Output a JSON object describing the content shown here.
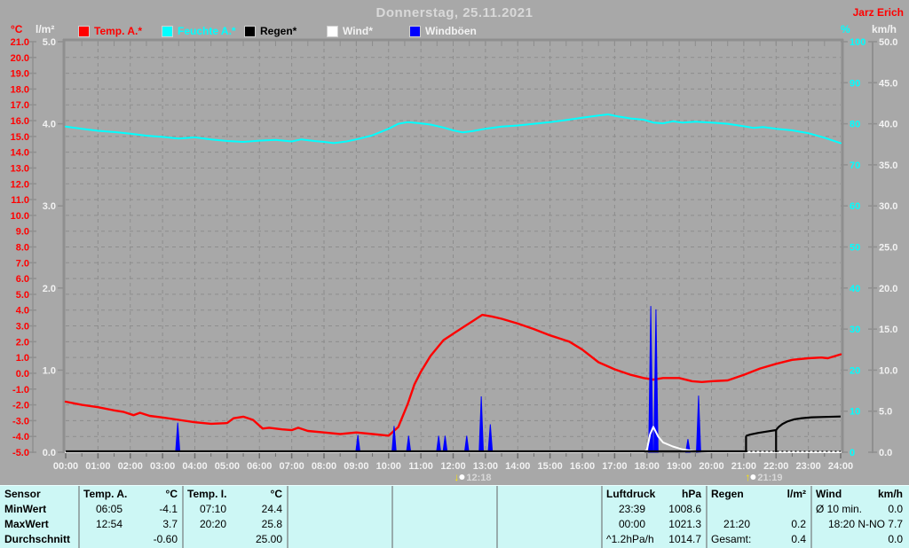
{
  "header": {
    "title": "Donnerstag, 25.11.2021",
    "credit": "Jarz Erich"
  },
  "legend": {
    "items": [
      {
        "label": "Temp. A.*",
        "color": "#ff0000",
        "text_color": "#ff0000"
      },
      {
        "label": "Feuchte A.*",
        "color": "#00ffff",
        "text_color": "#00ffff"
      },
      {
        "label": "Regen*",
        "color": "#000000",
        "text_color": "#000000"
      },
      {
        "label": "Wind*",
        "color": "#ffffff",
        "text_color": "#f2f2f2"
      },
      {
        "label": "Windböen",
        "color": "#0000ff",
        "text_color": "#f2f2f2"
      }
    ]
  },
  "chart_data": {
    "type": "line",
    "title": "Donnerstag, 25.11.2021",
    "x_range_hours": [
      0,
      24
    ],
    "grid": "dashed, hourly vertical, 1°C horizontal",
    "axes": {
      "temp_c": {
        "label": "°C",
        "color": "#ff0000",
        "range": [
          -5,
          21
        ],
        "ticks": [
          "21.0",
          "20.0",
          "19.0",
          "18.0",
          "17.0",
          "16.0",
          "15.0",
          "14.0",
          "13.0",
          "12.0",
          "11.0",
          "10.0",
          "9.0",
          "8.0",
          "7.0",
          "6.0",
          "5.0",
          "4.0",
          "3.0",
          "2.0",
          "1.0",
          "0.0",
          "-1.0",
          "-2.0",
          "-3.0",
          "-4.0",
          "-5.0"
        ]
      },
      "lm2": {
        "label": "l/m²",
        "color": "#f2f2f2",
        "range": [
          0,
          5
        ],
        "ticks": [
          "5.0",
          "4.0",
          "3.0",
          "2.0",
          "1.0",
          "0.0"
        ]
      },
      "percent": {
        "label": "%",
        "color": "#00ffff",
        "range": [
          0,
          100
        ],
        "ticks": [
          "100",
          "90",
          "80",
          "70",
          "60",
          "50",
          "40",
          "30",
          "20",
          "10",
          "0"
        ]
      },
      "kmh": {
        "label": "km/h",
        "color": "#f2f2f2",
        "range": [
          0,
          50
        ],
        "ticks": [
          "50.0",
          "45.0",
          "40.0",
          "35.0",
          "30.0",
          "25.0",
          "20.0",
          "15.0",
          "10.0",
          "5.0",
          "0.0"
        ]
      }
    },
    "x_ticks": [
      "00:00",
      "01:00",
      "02:00",
      "03:00",
      "04:00",
      "05:00",
      "06:00",
      "07:00",
      "08:00",
      "09:00",
      "10:00",
      "11:00",
      "12:00",
      "13:00",
      "14:00",
      "15:00",
      "16:00",
      "17:00",
      "18:00",
      "19:00",
      "20:00",
      "21:00",
      "22:00",
      "23:00",
      "24:00"
    ],
    "sun_markers": [
      {
        "label": "12:18",
        "time": "12:18",
        "direction": "down"
      },
      {
        "label": "21:19",
        "time": "21:19",
        "direction": "up"
      }
    ],
    "series": [
      {
        "name": "Feuchte A.",
        "axis": "percent",
        "color": "#00ffff",
        "style": "line",
        "points": [
          [
            0,
            79.3
          ],
          [
            0.5,
            78.8
          ],
          [
            1,
            78.3
          ],
          [
            1.5,
            78.0
          ],
          [
            2,
            77.6
          ],
          [
            2.5,
            77.1
          ],
          [
            3,
            76.8
          ],
          [
            3.5,
            76.4
          ],
          [
            4,
            76.7
          ],
          [
            4.5,
            76.2
          ],
          [
            5,
            75.8
          ],
          [
            5.5,
            75.6
          ],
          [
            6,
            75.9
          ],
          [
            6.5,
            76.1
          ],
          [
            7,
            75.7
          ],
          [
            7.3,
            76.2
          ],
          [
            7.7,
            75.8
          ],
          [
            8,
            75.6
          ],
          [
            8.3,
            75.3
          ],
          [
            8.7,
            75.7
          ],
          [
            9,
            76.2
          ],
          [
            9.5,
            77.2
          ],
          [
            10,
            78.8
          ],
          [
            10.3,
            80.0
          ],
          [
            10.6,
            80.4
          ],
          [
            11,
            80.1
          ],
          [
            11.3,
            79.8
          ],
          [
            11.7,
            79.1
          ],
          [
            12,
            78.4
          ],
          [
            12.3,
            77.9
          ],
          [
            12.6,
            78.2
          ],
          [
            13,
            78.8
          ],
          [
            13.5,
            79.3
          ],
          [
            14,
            79.6
          ],
          [
            14.5,
            80.0
          ],
          [
            15,
            80.4
          ],
          [
            15.5,
            80.9
          ],
          [
            16,
            81.5
          ],
          [
            16.5,
            82.0
          ],
          [
            16.8,
            82.3
          ],
          [
            17.1,
            81.8
          ],
          [
            17.5,
            81.3
          ],
          [
            17.9,
            81.0
          ],
          [
            18.2,
            80.3
          ],
          [
            18.5,
            80.1
          ],
          [
            18.8,
            80.6
          ],
          [
            19.1,
            80.3
          ],
          [
            19.5,
            80.5
          ],
          [
            20,
            80.3
          ],
          [
            20.5,
            80.0
          ],
          [
            21,
            79.4
          ],
          [
            21.3,
            79.0
          ],
          [
            21.6,
            79.2
          ],
          [
            22,
            78.8
          ],
          [
            22.5,
            78.4
          ],
          [
            23,
            77.7
          ],
          [
            23.5,
            76.6
          ],
          [
            24,
            75.3
          ]
        ]
      },
      {
        "name": "Temp. A.",
        "axis": "temp_c",
        "color": "#ff0000",
        "style": "line",
        "points": [
          [
            0,
            -1.8
          ],
          [
            0.5,
            -2.0
          ],
          [
            1,
            -2.15
          ],
          [
            1.5,
            -2.35
          ],
          [
            1.8,
            -2.45
          ],
          [
            2.1,
            -2.65
          ],
          [
            2.3,
            -2.5
          ],
          [
            2.6,
            -2.7
          ],
          [
            3,
            -2.8
          ],
          [
            3.5,
            -2.95
          ],
          [
            4,
            -3.1
          ],
          [
            4.5,
            -3.2
          ],
          [
            5,
            -3.15
          ],
          [
            5.2,
            -2.85
          ],
          [
            5.5,
            -2.75
          ],
          [
            5.8,
            -2.95
          ],
          [
            6.1,
            -3.5
          ],
          [
            6.3,
            -3.45
          ],
          [
            6.7,
            -3.55
          ],
          [
            7,
            -3.6
          ],
          [
            7.2,
            -3.45
          ],
          [
            7.5,
            -3.65
          ],
          [
            8,
            -3.75
          ],
          [
            8.5,
            -3.85
          ],
          [
            9,
            -3.75
          ],
          [
            9.5,
            -3.85
          ],
          [
            10,
            -3.95
          ],
          [
            10.3,
            -3.4
          ],
          [
            10.6,
            -1.9
          ],
          [
            10.8,
            -0.7
          ],
          [
            11,
            0.1
          ],
          [
            11.3,
            1.1
          ],
          [
            11.7,
            2.1
          ],
          [
            12,
            2.5
          ],
          [
            12.3,
            2.9
          ],
          [
            12.6,
            3.3
          ],
          [
            12.9,
            3.7
          ],
          [
            13.2,
            3.6
          ],
          [
            13.5,
            3.45
          ],
          [
            14,
            3.15
          ],
          [
            14.5,
            2.8
          ],
          [
            15,
            2.4
          ],
          [
            15.6,
            2.0
          ],
          [
            16,
            1.5
          ],
          [
            16.5,
            0.7
          ],
          [
            17,
            0.25
          ],
          [
            17.5,
            -0.1
          ],
          [
            17.9,
            -0.3
          ],
          [
            18.2,
            -0.4
          ],
          [
            18.5,
            -0.3
          ],
          [
            19,
            -0.3
          ],
          [
            19.4,
            -0.5
          ],
          [
            19.7,
            -0.55
          ],
          [
            20,
            -0.5
          ],
          [
            20.5,
            -0.45
          ],
          [
            21,
            -0.1
          ],
          [
            21.5,
            0.3
          ],
          [
            22,
            0.6
          ],
          [
            22.5,
            0.85
          ],
          [
            23,
            0.95
          ],
          [
            23.4,
            1.0
          ],
          [
            23.6,
            0.95
          ],
          [
            24,
            1.2
          ]
        ]
      },
      {
        "name": "Windböen",
        "axis": "kmh",
        "color": "#0000ff",
        "style": "spikes",
        "points": [
          [
            3.47,
            3.6
          ],
          [
            9.05,
            2.1
          ],
          [
            10.17,
            3.2
          ],
          [
            10.62,
            2.0
          ],
          [
            11.55,
            2.0
          ],
          [
            11.75,
            2.0
          ],
          [
            12.42,
            2.0
          ],
          [
            12.87,
            6.8
          ],
          [
            13.15,
            3.4
          ],
          [
            18.12,
            17.8
          ],
          [
            18.28,
            17.4
          ],
          [
            19.27,
            1.6
          ],
          [
            19.6,
            6.9
          ]
        ]
      },
      {
        "name": "Wind",
        "axis": "kmh",
        "color": "#ffffff",
        "style": "line",
        "points": [
          [
            0,
            0
          ],
          [
            17.9,
            0
          ],
          [
            18.0,
            0.3
          ],
          [
            18.1,
            2.2
          ],
          [
            18.2,
            3.1
          ],
          [
            18.35,
            1.9
          ],
          [
            18.5,
            1.2
          ],
          [
            18.8,
            0.7
          ],
          [
            19.1,
            0.35
          ],
          [
            19.5,
            0.12
          ],
          [
            19.9,
            0
          ],
          [
            24,
            0
          ]
        ]
      },
      {
        "name": "Regen",
        "axis": "lm2",
        "color": "#000000",
        "style": "rain",
        "baseline_solid_until": 21.07,
        "tick_marks": [
          21.07,
          22.0
        ],
        "points": [
          [
            21.07,
            0.2
          ],
          [
            21.2,
            0.215
          ],
          [
            21.45,
            0.235
          ],
          [
            21.75,
            0.255
          ],
          [
            22.0,
            0.27
          ],
          [
            22.07,
            0.305
          ],
          [
            22.2,
            0.345
          ],
          [
            22.35,
            0.375
          ],
          [
            22.55,
            0.4
          ],
          [
            22.8,
            0.415
          ],
          [
            23.1,
            0.425
          ],
          [
            23.5,
            0.43
          ],
          [
            24,
            0.435
          ]
        ]
      }
    ]
  },
  "table": {
    "row_labels": [
      "Sensor",
      "MinWert",
      "MaxWert",
      "Durchschnitt"
    ],
    "columns": [
      {
        "name": "Temp. A.",
        "unit": "°C",
        "rows": [
          [
            "06:05",
            "-4.1"
          ],
          [
            "12:54",
            "3.7"
          ],
          [
            "",
            "-0.60"
          ]
        ]
      },
      {
        "name": "Temp. I.",
        "unit": "°C",
        "rows": [
          [
            "07:10",
            "24.4"
          ],
          [
            "20:20",
            "25.8"
          ],
          [
            "",
            "25.00"
          ]
        ]
      },
      {
        "name": "",
        "unit": "",
        "rows": [
          [
            "",
            ""
          ],
          [
            "",
            ""
          ],
          [
            "",
            ""
          ]
        ]
      },
      {
        "name": "",
        "unit": "",
        "rows": [
          [
            "",
            ""
          ],
          [
            "",
            ""
          ],
          [
            "",
            ""
          ]
        ]
      },
      {
        "name": "",
        "unit": "",
        "rows": [
          [
            "",
            ""
          ],
          [
            "",
            ""
          ],
          [
            "",
            ""
          ]
        ]
      },
      {
        "name": "Luftdruck",
        "unit": "hPa",
        "rows": [
          [
            "23:39",
            "1008.6"
          ],
          [
            "00:00",
            "1021.3"
          ],
          [
            "^1.2hPa/h",
            "1014.7"
          ]
        ]
      },
      {
        "name": "Regen",
        "unit": "l/m²",
        "rows": [
          [
            "",
            ""
          ],
          [
            "21:20",
            "0.2"
          ],
          [
            "Gesamt:",
            "0.4"
          ]
        ]
      },
      {
        "name": "Wind",
        "unit": "km/h",
        "rows": [
          [
            "Ø 10 min.",
            "0.0"
          ],
          [
            "18:20",
            "N-NO 7.7"
          ],
          [
            "",
            "0.0"
          ]
        ]
      }
    ]
  },
  "colors": {
    "background": "#a8a8a8",
    "grid": "#8d8d8d",
    "border": "#8f8f8f",
    "title_text": "#d9d9d9",
    "axis_text_light": "#f2f2f2",
    "table_bg": "#cdf7f5",
    "marker_yellow": "#ffe800"
  }
}
